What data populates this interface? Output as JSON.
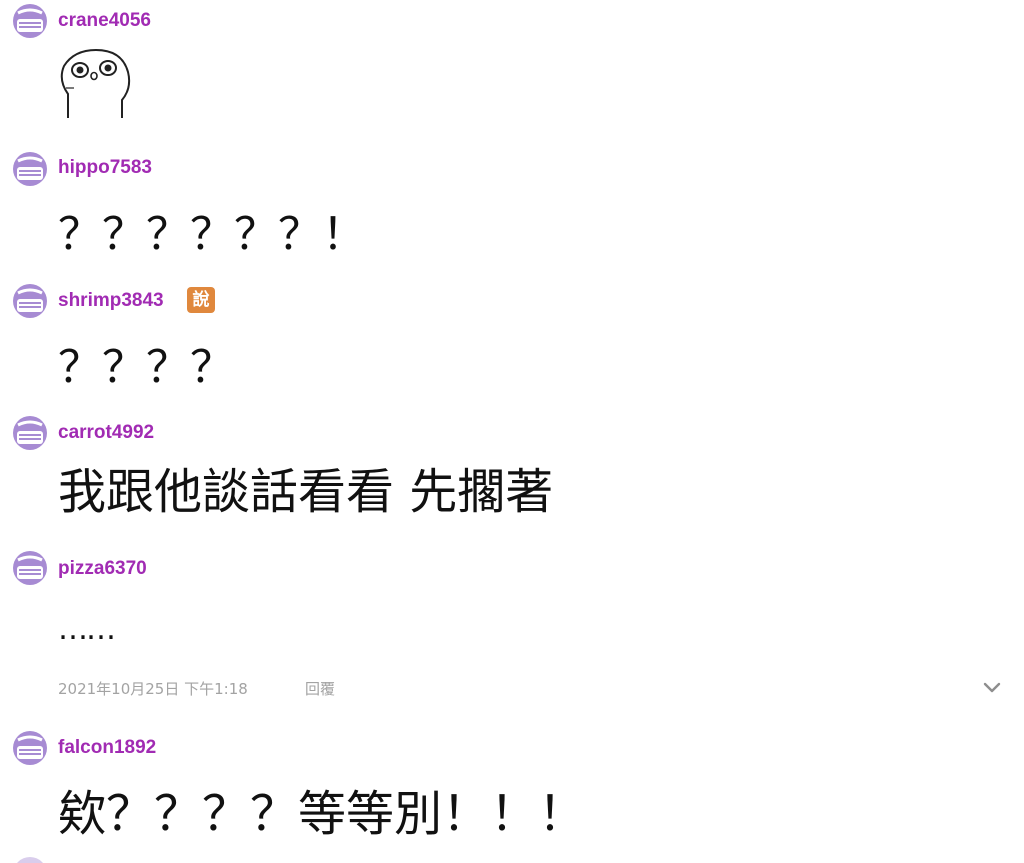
{
  "comments": [
    {
      "username": "crane4056",
      "content": "",
      "sticker": "ghost-face-sticker"
    },
    {
      "username": "hippo7583",
      "content": "？？？？？？！"
    },
    {
      "username": "shrimp3843",
      "badge": "說",
      "content": "？？？？"
    },
    {
      "username": "carrot4992",
      "content": "我跟他談話看看 先擱著"
    },
    {
      "username": "pizza6370",
      "content": "……",
      "timestamp": "2021年10月25日 下午1:18",
      "reply_label": "回覆"
    },
    {
      "username": "falcon1892",
      "content": "欸？？？？等等別！！！"
    }
  ],
  "colors": {
    "username": "#a12bb3",
    "avatar": "#a78bd3",
    "badge": "#e0883d",
    "meta": "#a3a3a3"
  },
  "icons": {
    "avatar": "masked-face-avatar-icon",
    "expand": "chevron-down-icon"
  }
}
